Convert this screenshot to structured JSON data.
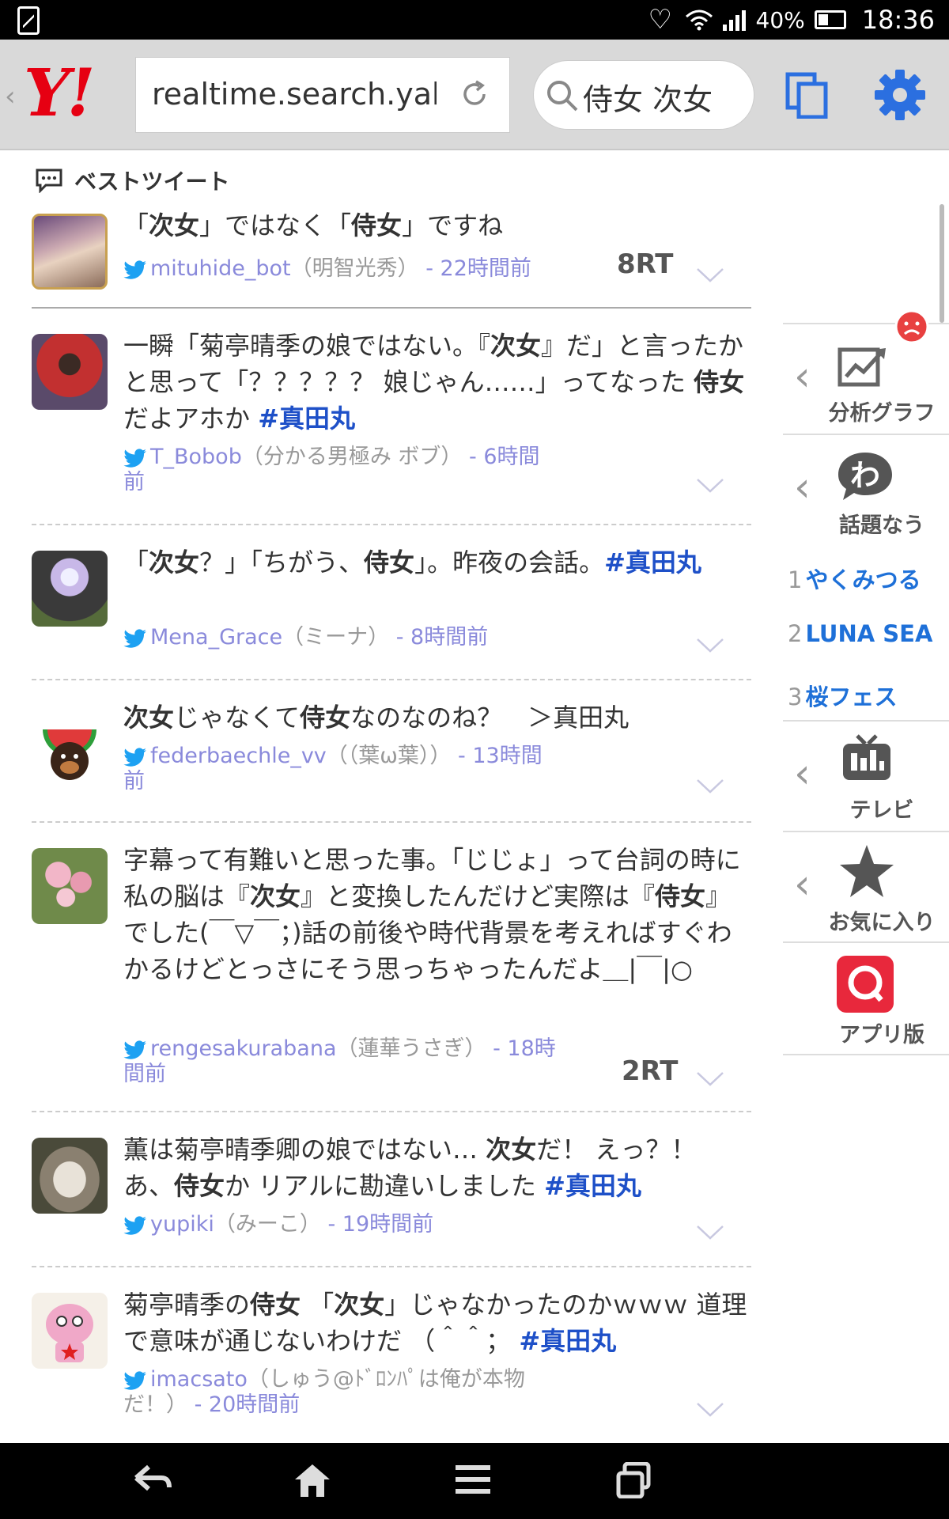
{
  "status_bar": {
    "battery": "40%",
    "time": "18:36"
  },
  "toolbar": {
    "logo": "Y!",
    "url": "realtime.search.yah…",
    "search_query": "侍女 次女"
  },
  "best_tweet_header": "ベストツイート",
  "tweets": [
    {
      "text_html": "「<b>次女</b>」ではなく「<b>侍女</b>」ですね",
      "user_id": "mituhide_bot",
      "user_name": "（明智光秀）",
      "time": "- 22時間前",
      "rt": "8RT"
    },
    {
      "text_html": "一瞬「菊亭晴季の娘ではない。『<b>次女</b>』だ」と言ったかと思って「？？？？？ 娘じゃん……」ってなった <b>侍女</b>だよアホか <span class=\"tag\">#真田丸</span>",
      "user_id": "T_Bobob",
      "user_name": "（分かる男極み ボブ）",
      "time": "- 6時間前",
      "rt": ""
    },
    {
      "text_html": "「<b>次女</b>？」「ちがう、<b>侍女</b>」。昨夜の会話。<span class=\"tag\">#真田丸</span>",
      "user_id": "Mena_Grace",
      "user_name": "（ミーナ）",
      "time": "- 8時間前",
      "rt": ""
    },
    {
      "text_html": "<b>次女</b>じゃなくて<b>侍女</b>なのなのね？　＞真田丸",
      "user_id": "federbaechle_vv",
      "user_name": "（（葉ω葉））",
      "time": "- 13時間前",
      "rt": ""
    },
    {
      "text_html": "字幕って有難いと思った事。「じじょ」って台詞の時に私の脳は『<b>次女</b>』と変換したんだけど実際は『<b>侍女</b>』でした(￣▽￣；)話の前後や時代背景を考えればすぐわかるけどとっさにそう思っちゃったんだよ＿|￣|○",
      "user_id": "rengesakurabana",
      "user_name": "（蓮華うさぎ）",
      "time": "- 18時間前",
      "rt": "2RT"
    },
    {
      "text_html": "薫は菊亭晴季卿の娘ではない… <b>次女</b>だ！ えっ？！ あ、<b>侍女</b>か リアルに勘違いしました <span class=\"tag\">#真田丸</span>",
      "user_id": "yupiki",
      "user_name": "（みーこ）",
      "time": "- 19時間前",
      "rt": ""
    },
    {
      "text_html": "菊亭晴季の<b>侍女</b> 「<b>次女</b>」じゃなかったのかｗｗｗ 道理で意味が通じないわけだ （＾＾； <span class=\"tag\">#真田丸</span>",
      "user_id": "imacsato",
      "user_name": "（しゅう@ﾄﾞﾛﾝﾊﾟは俺が本物だ！）",
      "time": "- 20時間前",
      "rt": ""
    }
  ],
  "sidebar": {
    "analysis_label": "分析グラフ",
    "trending_label": "話題なう",
    "trends": [
      {
        "rank": "1",
        "text": "やくみつる"
      },
      {
        "rank": "2",
        "text": "LUNA SEA"
      },
      {
        "rank": "3",
        "text": "桜フェス"
      }
    ],
    "tv_label": "テレビ",
    "favorites_label": "お気に入り",
    "app_label": "アプリ版"
  },
  "colors": {
    "brand_red": "#e60012",
    "accent_blue": "#1e70d8",
    "gear_blue": "#2b6fe0",
    "meta_purple": "#8a8adb",
    "twitter_blue": "#1da1f2"
  }
}
